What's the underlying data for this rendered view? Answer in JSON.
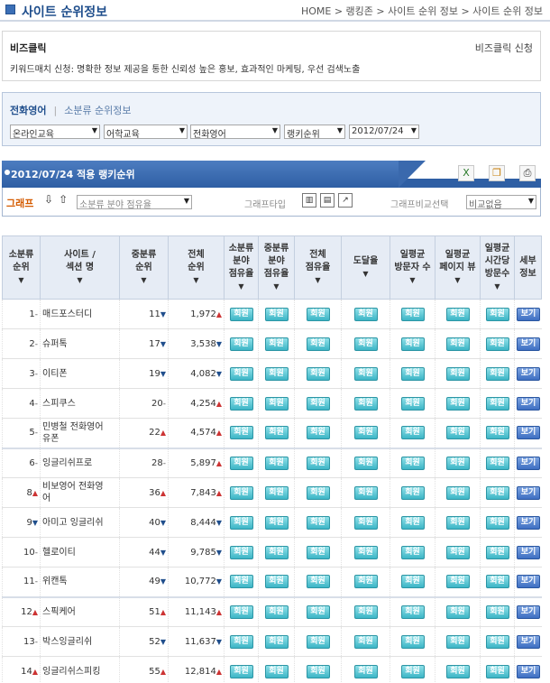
{
  "header": {
    "title": "사이트 순위정보",
    "breadcrumb": "HOME > 랭킹존 > 사이트 순위 정보 > 사이트 순위 정보"
  },
  "biz": {
    "title": "비즈클릭",
    "apply_label": "비즈클릭 신청",
    "desc": "키워드매치 신청: 명확한 정보 제공을 통한 신뢰성 높은 홍보, 효과적인 마케팅, 우선 검색노출"
  },
  "filter": {
    "tab_active": "전화영어",
    "tab_other": "소분류 순위정보",
    "select_1": "온라인교육",
    "select_2": "어학교육",
    "select_3": "전화영어",
    "select_4": "랭키순위",
    "select_5": "2012/07/24"
  },
  "rankbar": {
    "title": "2012/07/24 적용 랭키순위"
  },
  "graphbar": {
    "graph_label": "그래프",
    "graph_select": "소분류 분야 점유율",
    "type_label": "그래프타입",
    "compare_label": "그래프비교선택",
    "compare_select": "비교없음"
  },
  "table": {
    "headers": {
      "h0": "소분류\n순위",
      "h1": "사이트 /\n섹션 명",
      "h2": "중분류\n순위",
      "h3": "전체\n순위",
      "h4": "소분류\n분야\n점유율",
      "h5": "중분류\n분야\n점유율",
      "h6": "전체\n점유율",
      "h7": "도달율",
      "h8": "일평균\n방문자 수",
      "h9": "일평균\n페이지 뷰",
      "h10": "일평균\n시간당\n방문수",
      "h11": "세부\n정보"
    },
    "member_label": "회원",
    "view_label": "보기",
    "rows": [
      {
        "rank": "1",
        "rank_change": "eq",
        "name": "매드포스터디",
        "mid": "11",
        "mid_change": "dn",
        "all": "1,972",
        "all_change": "up"
      },
      {
        "rank": "2",
        "rank_change": "eq",
        "name": "슈퍼톡",
        "mid": "17",
        "mid_change": "dn",
        "all": "3,538",
        "all_change": "dn"
      },
      {
        "rank": "3",
        "rank_change": "eq",
        "name": "이티폰",
        "mid": "19",
        "mid_change": "dn",
        "all": "4,082",
        "all_change": "dn"
      },
      {
        "rank": "4",
        "rank_change": "eq",
        "name": "스피쿠스",
        "mid": "20",
        "mid_change": "eq",
        "all": "4,254",
        "all_change": "up"
      },
      {
        "rank": "5",
        "rank_change": "eq",
        "name": "민병철 전화영어\n유폰",
        "mid": "22",
        "mid_change": "up",
        "all": "4,574",
        "all_change": "up"
      },
      {
        "rank": "6",
        "rank_change": "eq",
        "name": "잉글리쉬프로",
        "mid": "28",
        "mid_change": "eq",
        "all": "5,897",
        "all_change": "up"
      },
      {
        "rank": "8",
        "rank_change": "up",
        "name": "비보영어 전화영\n어",
        "mid": "36",
        "mid_change": "up",
        "all": "7,843",
        "all_change": "up"
      },
      {
        "rank": "9",
        "rank_change": "dn",
        "name": "아미고 잉글리쉬",
        "mid": "40",
        "mid_change": "dn",
        "all": "8,444",
        "all_change": "dn"
      },
      {
        "rank": "10",
        "rank_change": "eq",
        "name": "헬로이티",
        "mid": "44",
        "mid_change": "dn",
        "all": "9,785",
        "all_change": "dn"
      },
      {
        "rank": "11",
        "rank_change": "eq",
        "name": "위캔톡",
        "mid": "49",
        "mid_change": "dn",
        "all": "10,772",
        "all_change": "dn"
      },
      {
        "rank": "12",
        "rank_change": "up",
        "name": "스픽케어",
        "mid": "51",
        "mid_change": "up",
        "all": "11,143",
        "all_change": "up"
      },
      {
        "rank": "13",
        "rank_change": "eq",
        "name": "박스잉글리쉬",
        "mid": "52",
        "mid_change": "dn",
        "all": "11,637",
        "all_change": "dn"
      },
      {
        "rank": "14",
        "rank_change": "up",
        "name": "잉글리쉬스피킹",
        "mid": "55",
        "mid_change": "up",
        "all": "12,814",
        "all_change": "up"
      }
    ]
  },
  "colors": {
    "brand_blue": "#1f4e8c",
    "up_red": "#cc3333",
    "member_cyan": "#3cb5c6",
    "view_blue": "#3e6fc2"
  }
}
